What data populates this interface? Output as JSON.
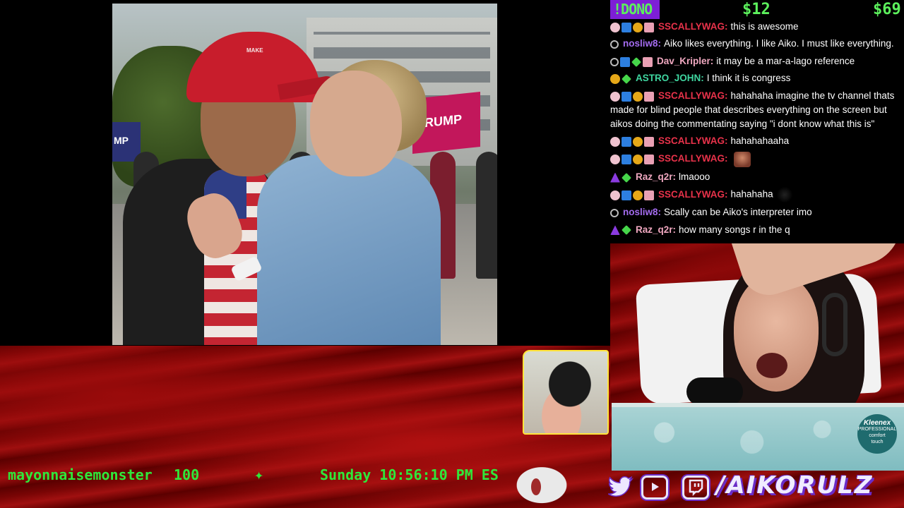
{
  "dono": {
    "command": "!DONO",
    "amount_1": "$12",
    "amount_2": "$69"
  },
  "chat": [
    {
      "user": "SSCALLYWAG:",
      "user_color": "#e8324a",
      "text": "this is awesome",
      "badges": [
        "sub",
        "blue",
        "gold",
        "gift"
      ]
    },
    {
      "user": "nosliw8:",
      "user_color": "#a46cf0",
      "text": "Aiko likes everything. I like Aiko. I must like everything.",
      "badges": [
        "user"
      ]
    },
    {
      "user": "Dav_Kripler:",
      "user_color": "#f0a8c0",
      "text": "it may be a mar-a-lago reference",
      "badges": [
        "user",
        "blue",
        "green",
        "gift"
      ]
    },
    {
      "user": "ASTRO_JOHN:",
      "user_color": "#3fd6a0",
      "text": "I think it is congress",
      "badges": [
        "avatar",
        "green"
      ]
    },
    {
      "user": "SSCALLYWAG:",
      "user_color": "#e8324a",
      "text": "hahahaha imagine the tv channel thats made for blind people that describes everything on the screen but aikos doing the commentating saying \"i dont know what this is\"",
      "badges": [
        "sub",
        "blue",
        "gold",
        "gift"
      ]
    },
    {
      "user": "SSCALLYWAG:",
      "user_color": "#e8324a",
      "text": "hahahahaaha",
      "badges": [
        "sub",
        "blue",
        "gold",
        "gift"
      ]
    },
    {
      "user": "SSCALLYWAG:",
      "user_color": "#e8324a",
      "text": "",
      "emote": "face",
      "badges": [
        "sub",
        "blue",
        "gold",
        "gift"
      ]
    },
    {
      "user": "Raz_q2r:",
      "user_color": "#f0a8c0",
      "text": "lmaooo",
      "badges": [
        "purple",
        "green"
      ]
    },
    {
      "user": "SSCALLYWAG:",
      "user_color": "#e8324a",
      "text": "hahahaha",
      "emote": "cat",
      "badges": [
        "sub",
        "blue",
        "gold",
        "gift"
      ]
    },
    {
      "user": "nosliw8:",
      "user_color": "#a46cf0",
      "text": "Scally can be Aiko's interpreter imo",
      "badges": [
        "user"
      ]
    },
    {
      "user": "Raz_q2r:",
      "user_color": "#f0a8c0",
      "text": "how many songs r in the q",
      "badges": [
        "purple",
        "green"
      ]
    }
  ],
  "ticker": {
    "name": "mayonnaisemonster",
    "score": "100",
    "star": "✦",
    "clock": "Sunday 10:56:10 PM ES"
  },
  "webcam": {
    "box_brand": "Kleenex",
    "box_line1": "PROFESSIONAL",
    "box_line2": "comfort",
    "box_line3": "touch"
  },
  "social": {
    "twitter_icon": "twitter-icon",
    "youtube_icon": "youtube-icon",
    "twitch_icon": "twitch-icon",
    "handle": "/AIKORULZ"
  },
  "video": {
    "cap_text": "MAKE",
    "sign_left": "MP",
    "sign_right": "TRUMP"
  }
}
